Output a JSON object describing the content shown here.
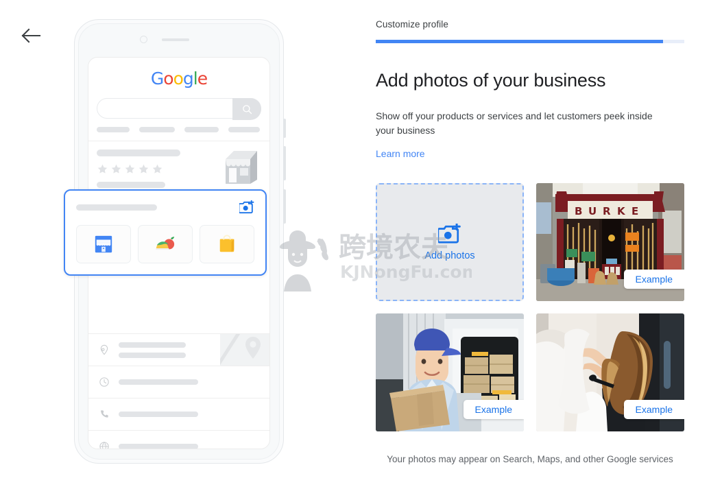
{
  "nav": {
    "back_icon": "arrow-left-icon"
  },
  "breadcrumb": {
    "label": "Customize profile"
  },
  "progress": {
    "percent": 93,
    "fill_color": "#4285f4",
    "track_color": "#e8eef9"
  },
  "main": {
    "headline": "Add photos of your business",
    "subtitle": "Show off your products or services and let customers peek inside your business",
    "learn_more": "Learn more",
    "footer_note": "Your photos may appear on Search, Maps, and other Google services"
  },
  "dropzone": {
    "label": "Add photos",
    "icon": "add-a-photo-icon",
    "border_color": "#8ab4f8",
    "fill_color": "#e8eaed",
    "text_color": "#1a73e8"
  },
  "examples": [
    {
      "badge": "Example",
      "alt": "storefront-hardware-shop",
      "sign_text": "BURKE"
    },
    {
      "badge": "Example",
      "alt": "delivery-person-with-boxes"
    },
    {
      "badge": "Example",
      "alt": "hair-salon-stylist"
    }
  ],
  "phone": {
    "logo": {
      "text": "Google",
      "letters": [
        "G",
        "o",
        "o",
        "g",
        "l",
        "e"
      ],
      "colors": [
        "#4285f4",
        "#ea4335",
        "#fbbc05",
        "#4285f4",
        "#34a853",
        "#ea4335"
      ]
    },
    "search": {
      "placeholder": "",
      "icon": "search-icon"
    },
    "rating": {
      "stars": 5,
      "star_color": "#e0e2e5"
    },
    "photo_card": {
      "icon": "add-a-photo-icon",
      "accent": "#4285f4",
      "tiles": [
        "storefront-tile",
        "food-tile",
        "shopping-bag-tile"
      ]
    },
    "info_rows": [
      {
        "icon": "location-pin-icon",
        "lines": 2,
        "has_map": true
      },
      {
        "icon": "clock-icon",
        "lines": 1,
        "has_map": false
      },
      {
        "icon": "phone-icon",
        "lines": 1,
        "has_map": false
      },
      {
        "icon": "globe-icon",
        "lines": 1,
        "has_map": false
      }
    ]
  },
  "watermark": {
    "cn": "跨境农夫",
    "site": "KJNongFu.com",
    "icon": "farmer-avatar-icon"
  }
}
